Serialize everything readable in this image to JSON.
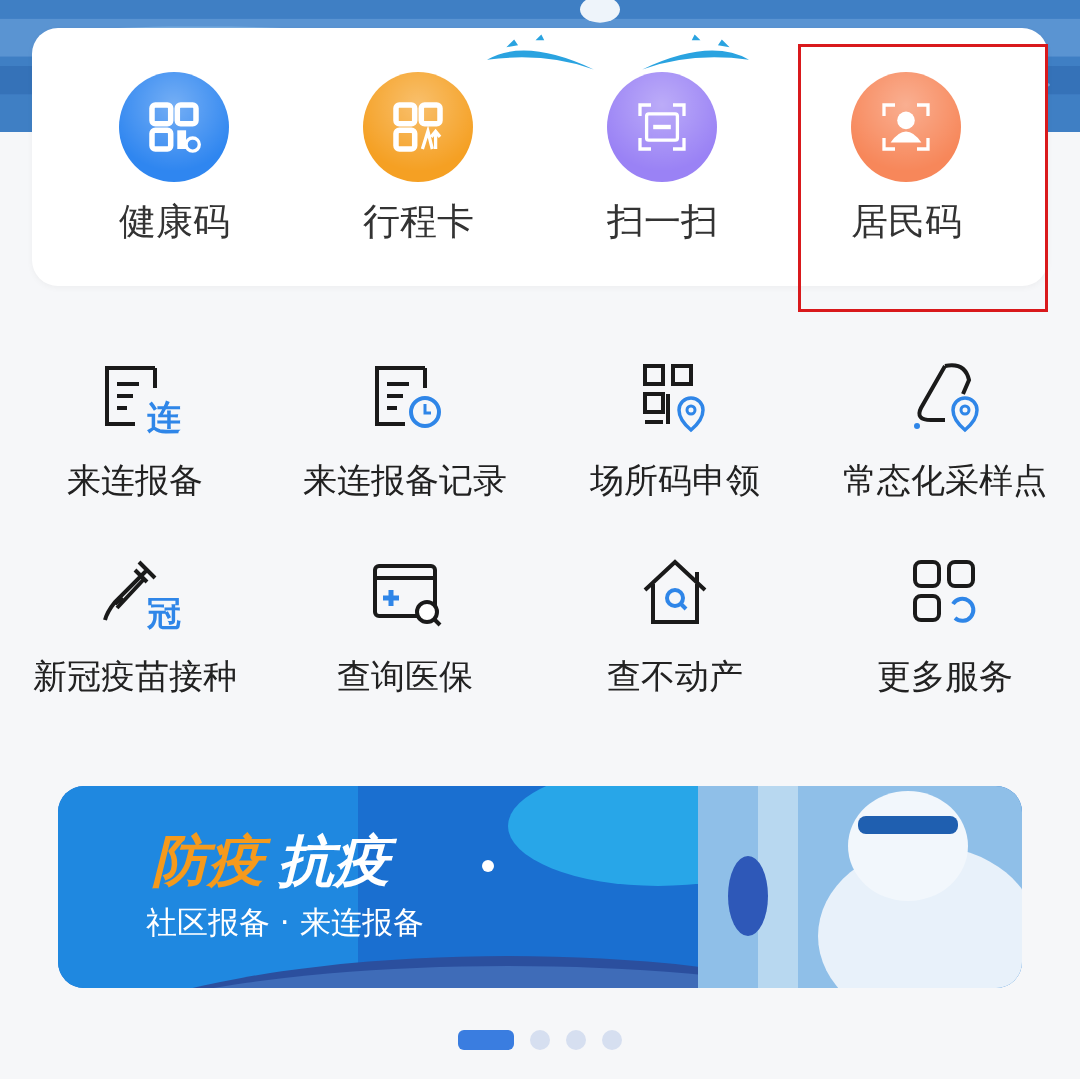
{
  "quick_actions": [
    {
      "label": "健康码",
      "kind": "qr",
      "color": "#2f86f0",
      "highlighted": false
    },
    {
      "label": "行程卡",
      "kind": "qr-up",
      "color": "#f5a023",
      "highlighted": false
    },
    {
      "label": "扫一扫",
      "kind": "scan",
      "color": "#9a82f5",
      "highlighted": false
    },
    {
      "label": "居民码",
      "kind": "person-scan",
      "color": "#f7875a",
      "highlighted": true
    }
  ],
  "services": [
    {
      "label": "来连报备",
      "kind": "doc-tag",
      "icon_text": "连"
    },
    {
      "label": "来连报备记录",
      "kind": "doc-clock"
    },
    {
      "label": "场所码申领",
      "kind": "qr-pin"
    },
    {
      "label": "常态化采样点",
      "kind": "swab-pin"
    },
    {
      "label": "新冠疫苗接种",
      "kind": "syringe",
      "icon_text": "冠"
    },
    {
      "label": "查询医保",
      "kind": "card-search"
    },
    {
      "label": "查不动产",
      "kind": "house-search"
    },
    {
      "label": "更多服务",
      "kind": "grid-more"
    }
  ],
  "banner": {
    "title": [
      {
        "text": "防疫",
        "color": "#f59a1c"
      },
      {
        "text": "抗疫",
        "color": "#ffffff"
      }
    ],
    "subtitle": "社区报备 · 来连报备"
  },
  "pager": [
    {
      "selected": true
    },
    {
      "selected": false
    },
    {
      "selected": false
    },
    {
      "selected": false
    }
  ]
}
